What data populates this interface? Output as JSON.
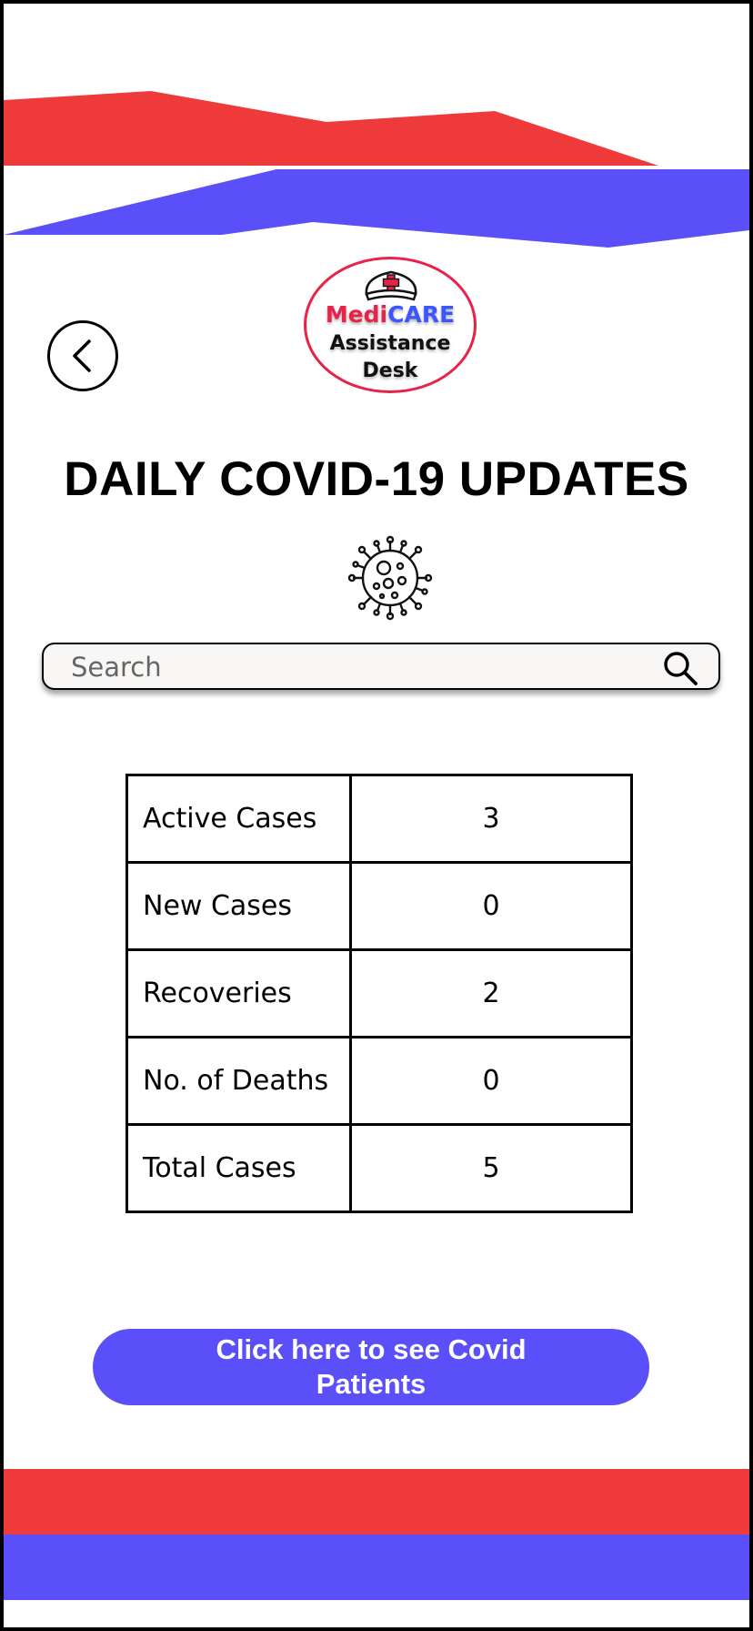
{
  "header": {
    "back_button_label": "Back",
    "logo": {
      "brand_first": "Medi",
      "brand_second": "CARE",
      "line2": "Assistance",
      "line3": "Desk"
    }
  },
  "title": "DAILY COVID-19 UPDATES",
  "search": {
    "placeholder": "Search",
    "value": ""
  },
  "stats": {
    "rows": [
      {
        "label": "Active Cases",
        "value": "3"
      },
      {
        "label": "New Cases",
        "value": "0"
      },
      {
        "label": "Recoveries",
        "value": "2"
      },
      {
        "label": "No. of Deaths",
        "value": "0"
      },
      {
        "label": "Total Cases",
        "value": "5"
      }
    ]
  },
  "cta": {
    "label": "Click here to see Covid Patients"
  },
  "colors": {
    "accent_red": "#ee3a3a",
    "accent_blue": "#5a4ff8",
    "logo_red": "#e8234a",
    "logo_blue": "#3b55ff"
  },
  "icons": {
    "back": "chevron-left-icon",
    "logo": "nurse-cap-icon",
    "virus": "virus-icon",
    "search": "search-icon"
  }
}
